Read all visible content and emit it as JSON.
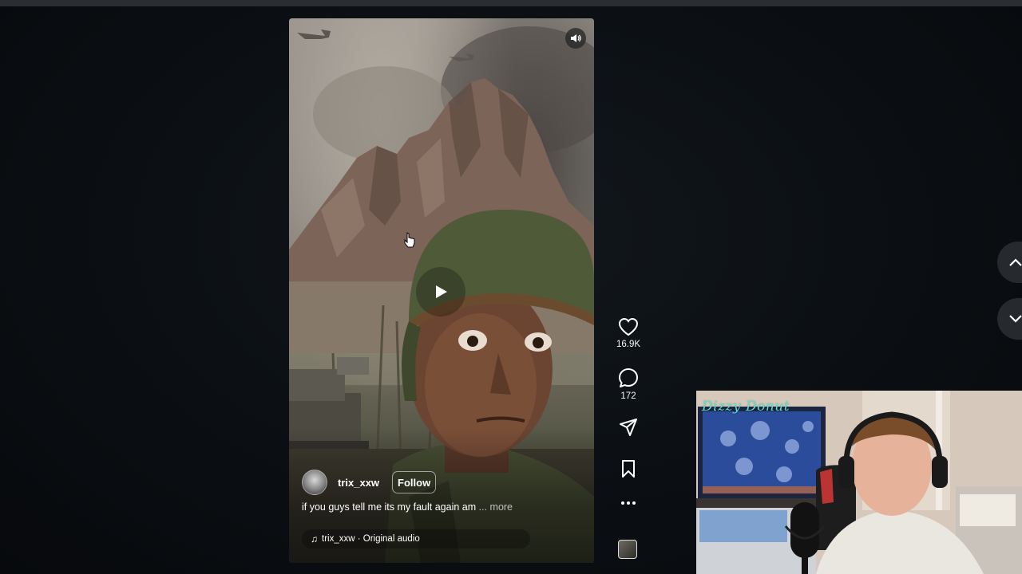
{
  "reel": {
    "username": "trix_xxw",
    "follow_label": "Follow",
    "caption": "if you guys tell me its my fault again am",
    "caption_more": "... more",
    "audio": "trix_xxw · Original audio",
    "icons": {
      "mute": "speaker-icon",
      "play": "play-icon",
      "audio": "music-note-icon"
    }
  },
  "actions": {
    "like_count": "16.9K",
    "comment_count": "172",
    "icons": [
      "heart-icon",
      "comment-icon",
      "share-icon",
      "bookmark-icon",
      "more-icon"
    ]
  },
  "navigation": {
    "icons": [
      "chevron-up-icon",
      "chevron-down-icon"
    ]
  },
  "webcam": {
    "overlay_text": "Dizzy   Donut"
  },
  "colors": {
    "background": "#0a0d10",
    "webcam_text": "#58e0d0",
    "nav_button": "#262a2e"
  }
}
